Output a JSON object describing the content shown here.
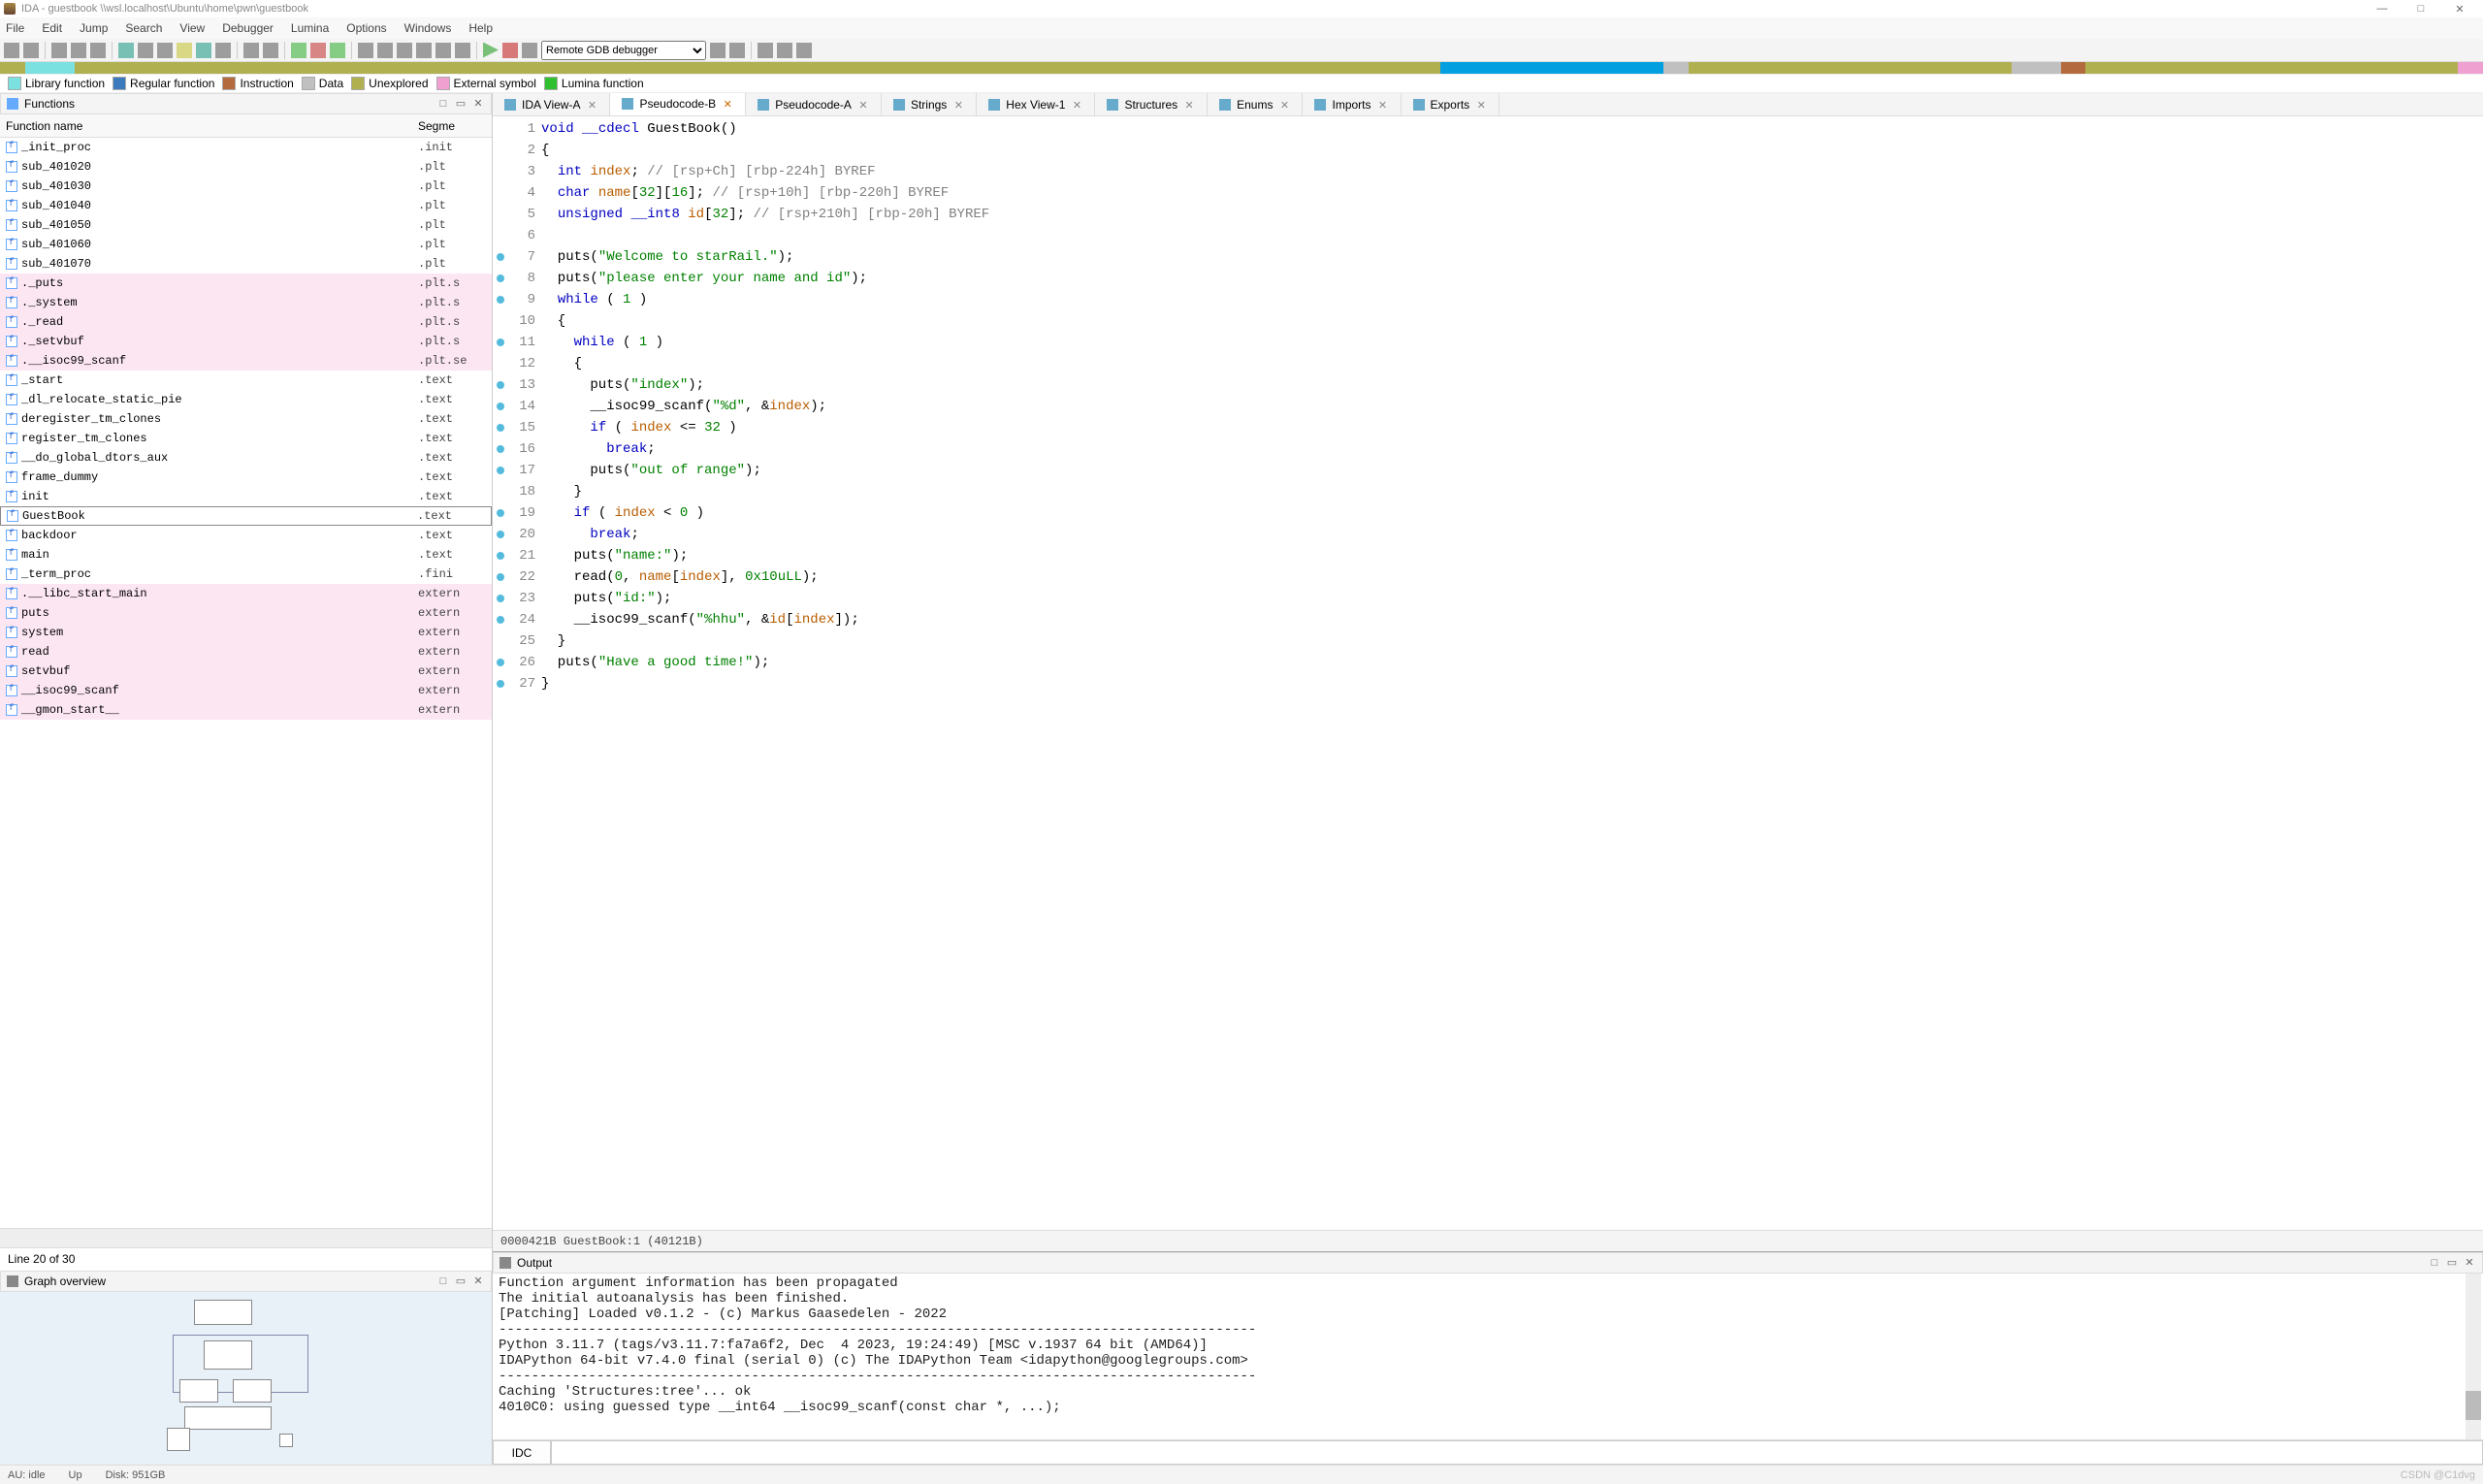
{
  "window": {
    "title": "IDA - guestbook \\\\wsl.localhost\\Ubuntu\\home\\pwn\\guestbook",
    "minimize": "—",
    "maximize": "□",
    "close": "✕"
  },
  "menu": [
    "File",
    "Edit",
    "Jump",
    "Search",
    "View",
    "Debugger",
    "Lumina",
    "Options",
    "Windows",
    "Help"
  ],
  "debugger_select": "Remote GDB debugger",
  "legend": [
    {
      "color": "#7be0e0",
      "label": "Library function"
    },
    {
      "color": "#3a7abd",
      "label": "Regular function"
    },
    {
      "color": "#b36b3d",
      "label": "Instruction"
    },
    {
      "color": "#c0c0c0",
      "label": "Data"
    },
    {
      "color": "#b0b050",
      "label": "Unexplored"
    },
    {
      "color": "#f0a0d0",
      "label": "External symbol"
    },
    {
      "color": "#30c030",
      "label": "Lumina function"
    }
  ],
  "functions_panel": {
    "title": "Functions",
    "col_name": "Function name",
    "col_seg": "Segme",
    "rows": [
      {
        "name": "_init_proc",
        "seg": ".init",
        "pink": false
      },
      {
        "name": "sub_401020",
        "seg": ".plt",
        "pink": false
      },
      {
        "name": "sub_401030",
        "seg": ".plt",
        "pink": false
      },
      {
        "name": "sub_401040",
        "seg": ".plt",
        "pink": false
      },
      {
        "name": "sub_401050",
        "seg": ".plt",
        "pink": false
      },
      {
        "name": "sub_401060",
        "seg": ".plt",
        "pink": false
      },
      {
        "name": "sub_401070",
        "seg": ".plt",
        "pink": false
      },
      {
        "name": "._puts",
        "seg": ".plt.s",
        "pink": true
      },
      {
        "name": "._system",
        "seg": ".plt.s",
        "pink": true
      },
      {
        "name": "._read",
        "seg": ".plt.s",
        "pink": true
      },
      {
        "name": "._setvbuf",
        "seg": ".plt.s",
        "pink": true
      },
      {
        "name": ".__isoc99_scanf",
        "seg": ".plt.se",
        "pink": true
      },
      {
        "name": "_start",
        "seg": ".text",
        "pink": false
      },
      {
        "name": "_dl_relocate_static_pie",
        "seg": ".text",
        "pink": false
      },
      {
        "name": "deregister_tm_clones",
        "seg": ".text",
        "pink": false
      },
      {
        "name": "register_tm_clones",
        "seg": ".text",
        "pink": false
      },
      {
        "name": "__do_global_dtors_aux",
        "seg": ".text",
        "pink": false
      },
      {
        "name": "frame_dummy",
        "seg": ".text",
        "pink": false
      },
      {
        "name": "init",
        "seg": ".text",
        "pink": false
      },
      {
        "name": "GuestBook",
        "seg": ".text",
        "pink": false,
        "selected": true
      },
      {
        "name": "backdoor",
        "seg": ".text",
        "pink": false
      },
      {
        "name": "main",
        "seg": ".text",
        "pink": false
      },
      {
        "name": "_term_proc",
        "seg": ".fini",
        "pink": false
      },
      {
        "name": ".__libc_start_main",
        "seg": "extern",
        "pink": true
      },
      {
        "name": "puts",
        "seg": "extern",
        "pink": true
      },
      {
        "name": "system",
        "seg": "extern",
        "pink": true
      },
      {
        "name": "read",
        "seg": "extern",
        "pink": true
      },
      {
        "name": "setvbuf",
        "seg": "extern",
        "pink": true
      },
      {
        "name": "__isoc99_scanf",
        "seg": "extern",
        "pink": true
      },
      {
        "name": "__gmon_start__",
        "seg": "extern",
        "pink": true
      }
    ],
    "lineof": "Line 20 of 30"
  },
  "graph_panel": {
    "title": "Graph overview"
  },
  "tabs": [
    {
      "label": "IDA View-A",
      "active": false,
      "close": "✕"
    },
    {
      "label": "Pseudocode-B",
      "active": true,
      "close_orange": true,
      "close": "✕"
    },
    {
      "label": "Pseudocode-A",
      "active": false,
      "close": "✕"
    },
    {
      "label": "Strings",
      "active": false,
      "close": "✕"
    },
    {
      "label": "Hex View-1",
      "active": false,
      "close": "✕"
    },
    {
      "label": "Structures",
      "active": false,
      "close": "✕"
    },
    {
      "label": "Enums",
      "active": false,
      "close": "✕"
    },
    {
      "label": "Imports",
      "active": false,
      "close": "✕"
    },
    {
      "label": "Exports",
      "active": false,
      "close": "✕"
    }
  ],
  "code": {
    "lines": [
      {
        "n": 1,
        "dot": false,
        "html": "<span class='kw'>void</span> <span class='kw'>__cdecl</span> GuestBook()"
      },
      {
        "n": 2,
        "dot": false,
        "html": "{"
      },
      {
        "n": 3,
        "dot": false,
        "html": "  <span class='kw'>int</span> <span class='var'>index</span>; <span class='cmt'>// [rsp+Ch] [rbp-224h] BYREF</span>"
      },
      {
        "n": 4,
        "dot": false,
        "html": "  <span class='kw'>char</span> <span class='var'>name</span>[<span class='num'>32</span>][<span class='num'>16</span>]; <span class='cmt'>// [rsp+10h] [rbp-220h] BYREF</span>"
      },
      {
        "n": 5,
        "dot": false,
        "html": "  <span class='kw'>unsigned</span> <span class='kw'>__int8</span> <span class='var'>id</span>[<span class='num'>32</span>]; <span class='cmt'>// [rsp+210h] [rbp-20h] BYREF</span>"
      },
      {
        "n": 6,
        "dot": false,
        "html": ""
      },
      {
        "n": 7,
        "dot": true,
        "html": "  puts(<span class='str'>\"Welcome to starRail.\"</span>);"
      },
      {
        "n": 8,
        "dot": true,
        "html": "  puts(<span class='str'>\"please enter your name and id\"</span>);"
      },
      {
        "n": 9,
        "dot": true,
        "html": "  <span class='kw'>while</span> ( <span class='num'>1</span> )"
      },
      {
        "n": 10,
        "dot": false,
        "html": "  {"
      },
      {
        "n": 11,
        "dot": true,
        "html": "    <span class='kw'>while</span> ( <span class='num'>1</span> )"
      },
      {
        "n": 12,
        "dot": false,
        "html": "    {"
      },
      {
        "n": 13,
        "dot": true,
        "html": "      puts(<span class='str'>\"index\"</span>);"
      },
      {
        "n": 14,
        "dot": true,
        "html": "      __isoc99_scanf(<span class='str'>\"%d\"</span>, &amp;<span class='var'>index</span>);"
      },
      {
        "n": 15,
        "dot": true,
        "html": "      <span class='kw'>if</span> ( <span class='var'>index</span> &lt;= <span class='num'>32</span> )"
      },
      {
        "n": 16,
        "dot": true,
        "html": "        <span class='kw'>break</span>;"
      },
      {
        "n": 17,
        "dot": true,
        "html": "      puts(<span class='str'>\"out of range\"</span>);"
      },
      {
        "n": 18,
        "dot": false,
        "html": "    }"
      },
      {
        "n": 19,
        "dot": true,
        "html": "    <span class='kw'>if</span> ( <span class='var'>index</span> &lt; <span class='num'>0</span> )"
      },
      {
        "n": 20,
        "dot": true,
        "html": "      <span class='kw'>break</span>;"
      },
      {
        "n": 21,
        "dot": true,
        "html": "    puts(<span class='str'>\"name:\"</span>);"
      },
      {
        "n": 22,
        "dot": true,
        "html": "    read(<span class='num'>0</span>, <span class='var'>name</span>[<span class='var'>index</span>], <span class='num'>0x10uLL</span>);"
      },
      {
        "n": 23,
        "dot": true,
        "html": "    puts(<span class='str'>\"id:\"</span>);"
      },
      {
        "n": 24,
        "dot": true,
        "html": "    __isoc99_scanf(<span class='str'>\"%hhu\"</span>, &amp;<span class='var'>id</span>[<span class='var'>index</span>]);"
      },
      {
        "n": 25,
        "dot": false,
        "html": "  }"
      },
      {
        "n": 26,
        "dot": true,
        "html": "  puts(<span class='str'>\"Have a good time!\"</span>);"
      },
      {
        "n": 27,
        "dot": true,
        "html": "}"
      }
    ],
    "status": "0000421B GuestBook:1 (40121B)"
  },
  "output": {
    "title": "Output",
    "body": "Function argument information has been propagated\nThe initial autoanalysis has been finished.\n[Patching] Loaded v0.1.2 - (c) Markus Gaasedelen - 2022\n---------------------------------------------------------------------------------------------\nPython 3.11.7 (tags/v3.11.7:fa7a6f2, Dec  4 2023, 19:24:49) [MSC v.1937 64 bit (AMD64)]\nIDAPython 64-bit v7.4.0 final (serial 0) (c) The IDAPython Team <idapython@googlegroups.com>\n---------------------------------------------------------------------------------------------\nCaching 'Structures:tree'... ok\n4010C0: using guessed type __int64 __isoc99_scanf(const char *, ...);",
    "idc": "IDC"
  },
  "statusbar": {
    "au": "AU:  idle",
    "up": "Up",
    "disk": "Disk: 951GB",
    "watermark": "CSDN @C1dvg"
  }
}
